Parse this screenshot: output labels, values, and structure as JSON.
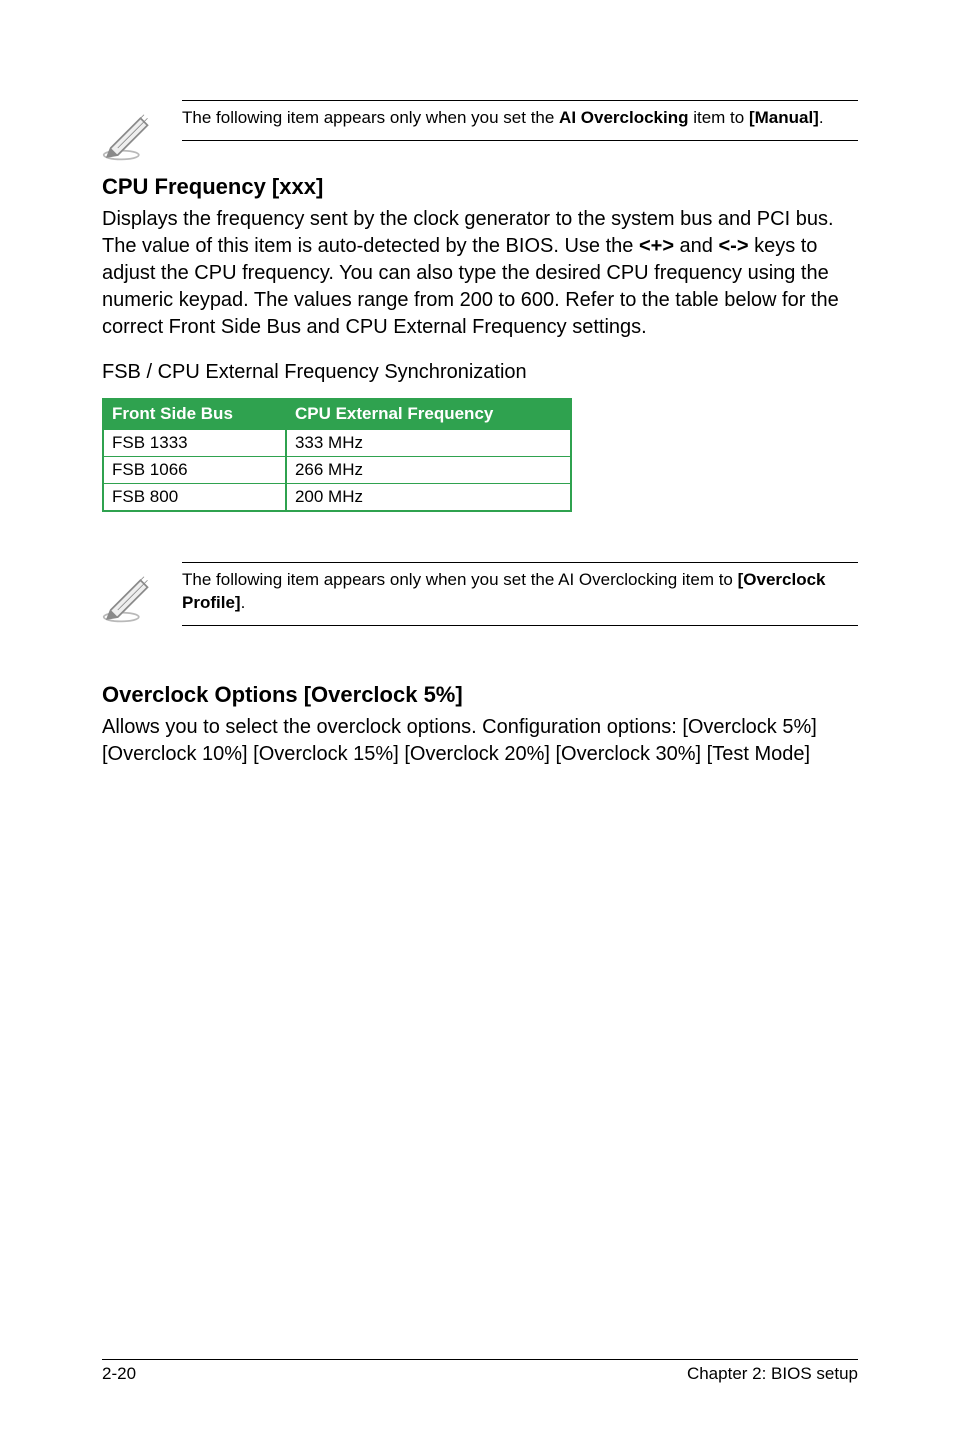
{
  "note1": {
    "pre": "The following item appears only when you set the ",
    "bold": "AI Overclocking",
    "mid": " item to ",
    "bold2": "[Manual]",
    "post": "."
  },
  "section1": {
    "heading": "CPU Frequency [xxx]",
    "body": "Displays the frequency sent by the clock generator to the system bus and PCI bus. The value of this item is auto-detected by the BIOS. Use the <+> and <-> keys to adjust the CPU frequency. You can also type the desired CPU frequency using the numeric keypad. The values range from 200 to 600. Refer to the table below for the correct Front Side Bus and CPU External Frequency settings.",
    "body_pre": "Displays the frequency sent by the clock generator to the system bus and PCI bus. The value of this item is auto-detected by the BIOS. Use the ",
    "body_k1": "<+>",
    "body_mid1": " and ",
    "body_k2": "<->",
    "body_mid2": " keys to adjust the CPU frequency. You can also type the desired CPU frequency using the numeric keypad. The values range from 200 to 600. Refer to the table below for the correct Front Side Bus and CPU External Frequency settings.",
    "tablecaption": "FSB / CPU External Frequency Synchronization",
    "th1": "Front Side Bus",
    "th2": "CPU External Frequency",
    "rows": [
      {
        "c1": "FSB 1333",
        "c2": "333 MHz"
      },
      {
        "c1": "FSB 1066",
        "c2": "266 MHz"
      },
      {
        "c1": "FSB 800",
        "c2": "200 MHz"
      }
    ]
  },
  "note2": {
    "pre": "The following item appears only when you set the AI Overclocking item to ",
    "bold": "[Overclock Profile]",
    "post": "."
  },
  "section2": {
    "heading": "Overclock Options [Overclock 5%]",
    "body": "Allows you to select the overclock options. Configuration options: [Overclock 5%] [Overclock 10%] [Overclock 15%] [Overclock 20%] [Overclock 30%] [Test Mode]"
  },
  "footer": {
    "left": "2-20",
    "right": "Chapter 2: BIOS setup"
  }
}
